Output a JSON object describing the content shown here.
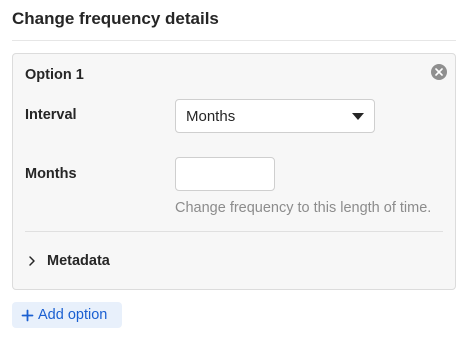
{
  "section": {
    "title": "Change frequency details"
  },
  "option": {
    "title": "Option 1",
    "interval": {
      "label": "Interval",
      "value": "Months"
    },
    "months": {
      "label": "Months",
      "value": "",
      "hint": "Change frequency to this length of time."
    },
    "metadata": {
      "label": "Metadata"
    }
  },
  "actions": {
    "add_option_label": "Add option"
  },
  "icons": {
    "remove": "close-circle-icon",
    "caret": "caret-down-icon",
    "chevron": "chevron-right-icon",
    "plus": "plus-icon"
  },
  "colors": {
    "accent": "#1a5fd1",
    "accent_bg": "#e8f0fb",
    "hint": "#8c8c8c"
  }
}
